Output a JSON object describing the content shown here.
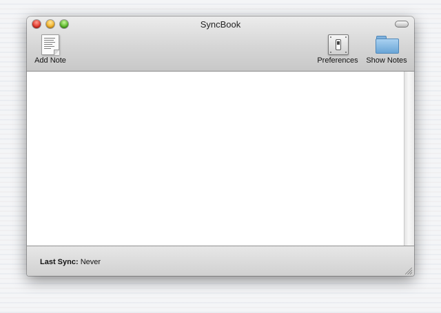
{
  "window": {
    "title": "SyncBook"
  },
  "toolbar": {
    "add_note": {
      "label": "Add Note",
      "icon": "note-icon"
    },
    "preferences": {
      "label": "Preferences",
      "icon": "toggle-switch-icon"
    },
    "show_notes": {
      "label": "Show Notes",
      "icon": "folder-icon"
    }
  },
  "status": {
    "label": "Last Sync:",
    "value": "Never"
  },
  "colors": {
    "close": "#e0362b",
    "minimize": "#f2b12a",
    "zoom": "#59b82a",
    "folder": "#6aa5d6"
  }
}
